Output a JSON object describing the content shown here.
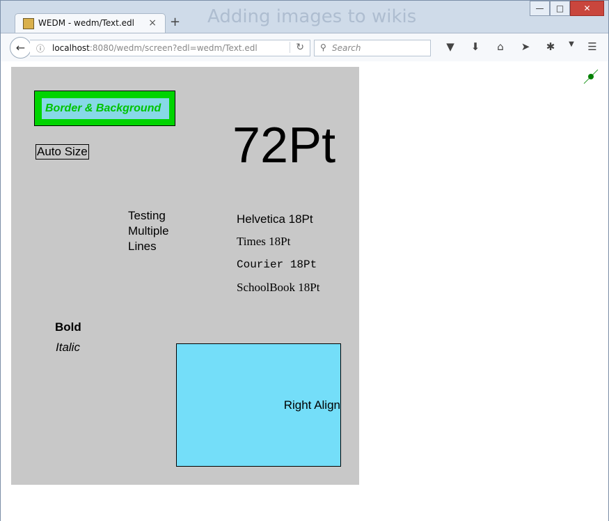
{
  "window": {
    "ghost_title": "Adding images to wikis",
    "controls": [
      "minimize",
      "maximize",
      "close"
    ]
  },
  "tab": {
    "title": "WEDM - wedm/Text.edl",
    "close_glyph": "×",
    "new_tab_glyph": "+"
  },
  "navbar": {
    "url_host": "localhost",
    "url_path": ":8080/wedm/screen?edl=wedm/Text.edl",
    "search_placeholder": "Search",
    "icons": [
      "pocket-icon",
      "download-icon",
      "home-icon",
      "send-icon",
      "addon-icon",
      "menu-icon"
    ]
  },
  "screen": {
    "border_background_label": "Border & Background",
    "auto_size_label": "Auto Size",
    "pt72_label": "72Pt",
    "multi_lines": [
      "Testing",
      "Multiple",
      "Lines"
    ],
    "helvetica_label": "Helvetica 18Pt",
    "times_label": "Times 18Pt",
    "courier_label": "Courier 18Pt",
    "schoolbook_label": "SchoolBook 18Pt",
    "bold_label": "Bold",
    "italic_label": "Italic",
    "right_align_label": "Right Align",
    "colors": {
      "background": "#c8c8c8",
      "green": "#00d400",
      "cyan": "#74def9"
    }
  }
}
